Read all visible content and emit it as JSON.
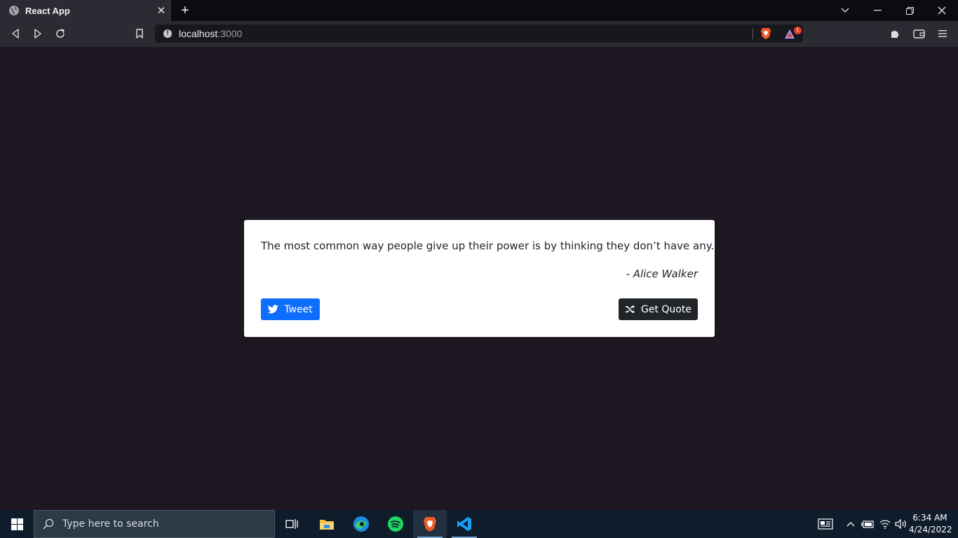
{
  "browser": {
    "tab_title": "React App",
    "url_host": "localhost",
    "url_port": ":3000",
    "notification_count": "1"
  },
  "quote": {
    "text": "The most common way people give up their power is by thinking they don’t have any.",
    "author": "- Alice Walker",
    "tweet_label": "Tweet",
    "get_quote_label": "Get Quote"
  },
  "taskbar": {
    "search_placeholder": "Type here to search",
    "time": "6:34 AM",
    "date": "4/24/2022"
  },
  "colors": {
    "page_bg": "#1d1721",
    "tweet_button": "#0d6efd",
    "get_quote_button": "#212529"
  }
}
